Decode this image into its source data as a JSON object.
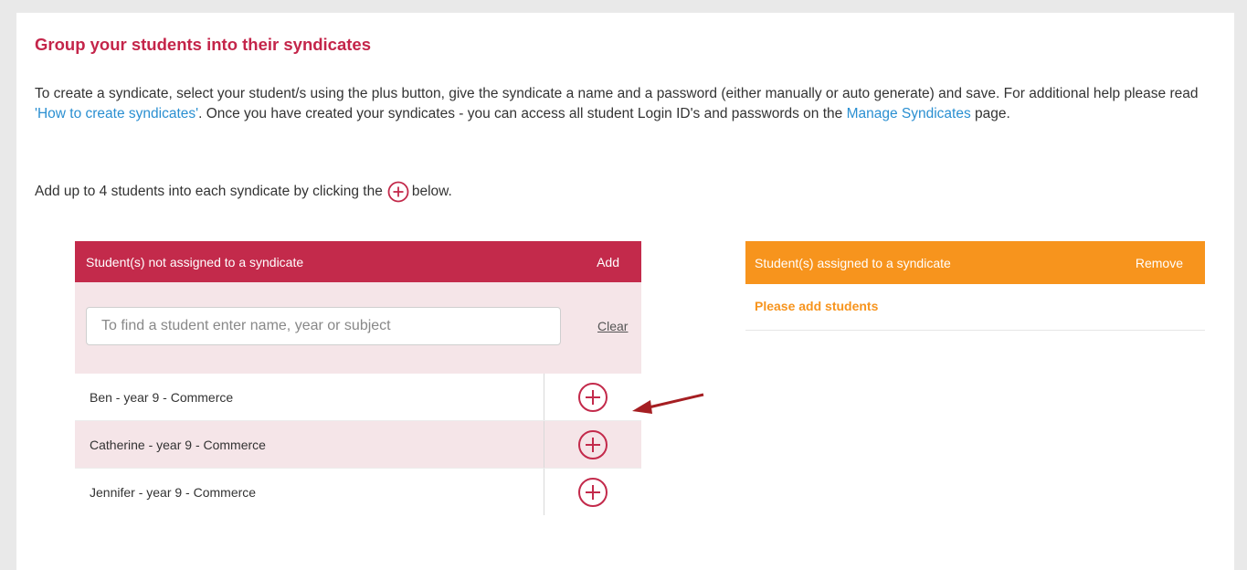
{
  "page": {
    "title": "Group your students into their syndicates",
    "intro": {
      "part1": "To create a syndicate, select your student/s using the plus button, give the syndicate a name and a password (either manually or auto generate) and save. For additional help please read ",
      "help_link": "'How to create syndicates'",
      "part2": ". Once you have created your syndicates - you can access all student Login ID's and passwords on the ",
      "manage_link": "Manage Syndicates",
      "part3": " page."
    },
    "hint": {
      "before": "Add up to 4 students into each syndicate by clicking the",
      "after": "below."
    }
  },
  "unassigned": {
    "header_title": "Student(s) not assigned to a syndicate",
    "header_action": "Add",
    "search_placeholder": "To find a student enter name, year or subject",
    "search_value": "",
    "clear_label": "Clear",
    "students": [
      {
        "name": "Ben - year 9 - Commerce"
      },
      {
        "name": "Catherine - year 9 - Commerce"
      },
      {
        "name": "Jennifer - year 9 - Commerce"
      }
    ]
  },
  "assigned": {
    "header_title": "Student(s) assigned to a syndicate",
    "header_action": "Remove",
    "empty_message": "Please add students"
  },
  "colors": {
    "brand_red": "#c32a4b",
    "accent_orange": "#f7941d",
    "link_blue": "#2a8fd1",
    "row_tint": "#f5e5e8"
  },
  "icons": {
    "add": "plus-circle-icon",
    "pointer": "arrow-icon"
  }
}
